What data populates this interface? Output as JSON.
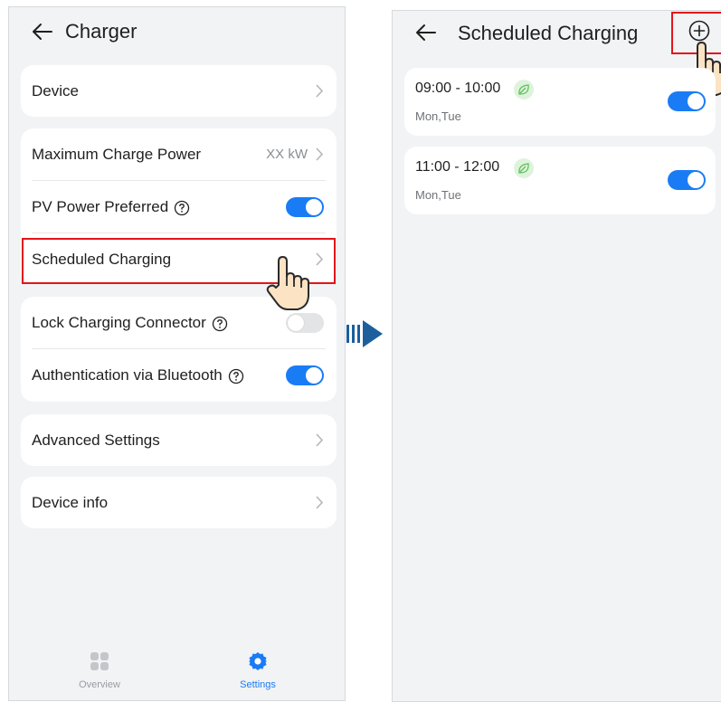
{
  "left_screen": {
    "title": "Charger",
    "card_device": {
      "label": "Device"
    },
    "card_power": {
      "max_power_label": "Maximum Charge Power",
      "max_power_value": "XX kW",
      "pv_label": "PV Power Preferred",
      "pv_enabled": true,
      "scheduled_label": "Scheduled Charging"
    },
    "card_security": {
      "lock_label": "Lock Charging Connector",
      "lock_enabled": false,
      "bt_label": "Authentication via Bluetooth",
      "bt_enabled": true
    },
    "advanced_label": "Advanced Settings",
    "device_info_label": "Device info",
    "nav": [
      {
        "label": "Overview",
        "icon": "overview-grid-icon",
        "active": false
      },
      {
        "label": "Settings",
        "icon": "gear-icon",
        "active": true
      }
    ]
  },
  "right_screen": {
    "title": "Scheduled Charging",
    "schedules": [
      {
        "time": "09:00 - 10:00",
        "days": "Mon,Tue",
        "enabled": true,
        "icon": "leaf-icon"
      },
      {
        "time": "11:00 - 12:00",
        "days": "Mon,Tue",
        "enabled": true,
        "icon": "leaf-icon"
      }
    ]
  },
  "colors": {
    "accent": "#1a7cf5",
    "highlight": "#e3141a",
    "background": "#f1f3f5",
    "flow_arrow": "#1c5f9c"
  }
}
